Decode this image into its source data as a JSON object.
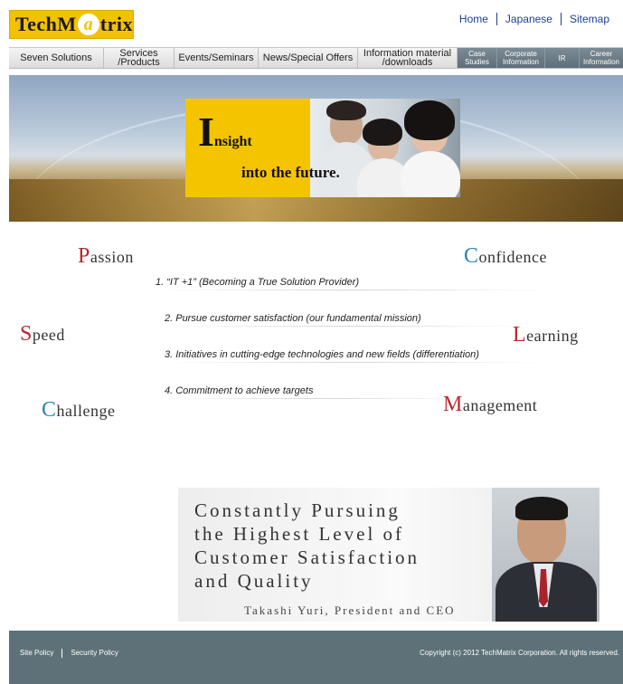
{
  "header": {
    "logo": {
      "part1": "TechM",
      "mark": "a",
      "part2": "trix"
    },
    "links": [
      "Home",
      "Japanese",
      "Sitemap"
    ]
  },
  "nav": [
    {
      "lines": [
        "Seven Solutions"
      ]
    },
    {
      "lines": [
        "Services",
        "/Products"
      ]
    },
    {
      "lines": [
        "Events/Seminars"
      ]
    },
    {
      "lines": [
        "News/Special Offers"
      ]
    },
    {
      "lines": [
        "Information material",
        "/downloads"
      ]
    },
    {
      "lines": [
        "Case",
        "Studies"
      ]
    },
    {
      "lines": [
        "Corporate",
        "Information"
      ]
    },
    {
      "lines": [
        "IR"
      ]
    },
    {
      "lines": [
        "Career",
        "Information"
      ]
    }
  ],
  "hero": {
    "initial": "I",
    "line1_rest": "nsight",
    "line2": "into the future."
  },
  "values": {
    "passion": {
      "initial": "P",
      "rest": "assion"
    },
    "confidence": {
      "initial": "C",
      "rest": "onfidence"
    },
    "speed": {
      "initial": "S",
      "rest": "peed"
    },
    "learning": {
      "initial": "L",
      "rest": "earning"
    },
    "challenge": {
      "initial": "C",
      "rest": "hallenge"
    },
    "management": {
      "initial": "M",
      "rest": "anagement"
    }
  },
  "policies": [
    "1. “IT +1” (Becoming a True Solution Provider)",
    "2. Pursue customer satisfaction (our fundamental mission)",
    "3. Initiatives in cutting-edge technologies and new fields (differentiation)",
    "4. Commitment to achieve targets"
  ],
  "ceo": {
    "message_lines": [
      "Constantly Pursuing",
      "the Highest Level of",
      "Customer Satisfaction",
      "and Quality"
    ],
    "name": "Takashi Yuri, President and CEO"
  },
  "footer": {
    "links": [
      "Site Policy",
      "Security Policy"
    ],
    "copyright": "Copyright (c) 2012 TechMatrix Corporation. All rights reserved."
  },
  "colors": {
    "brand_yellow": "#f2c200",
    "accent_red": "#b9272f",
    "accent_blue": "#2d83b5",
    "footer_bg": "#5e7179",
    "link_blue": "#1a3f9a"
  }
}
